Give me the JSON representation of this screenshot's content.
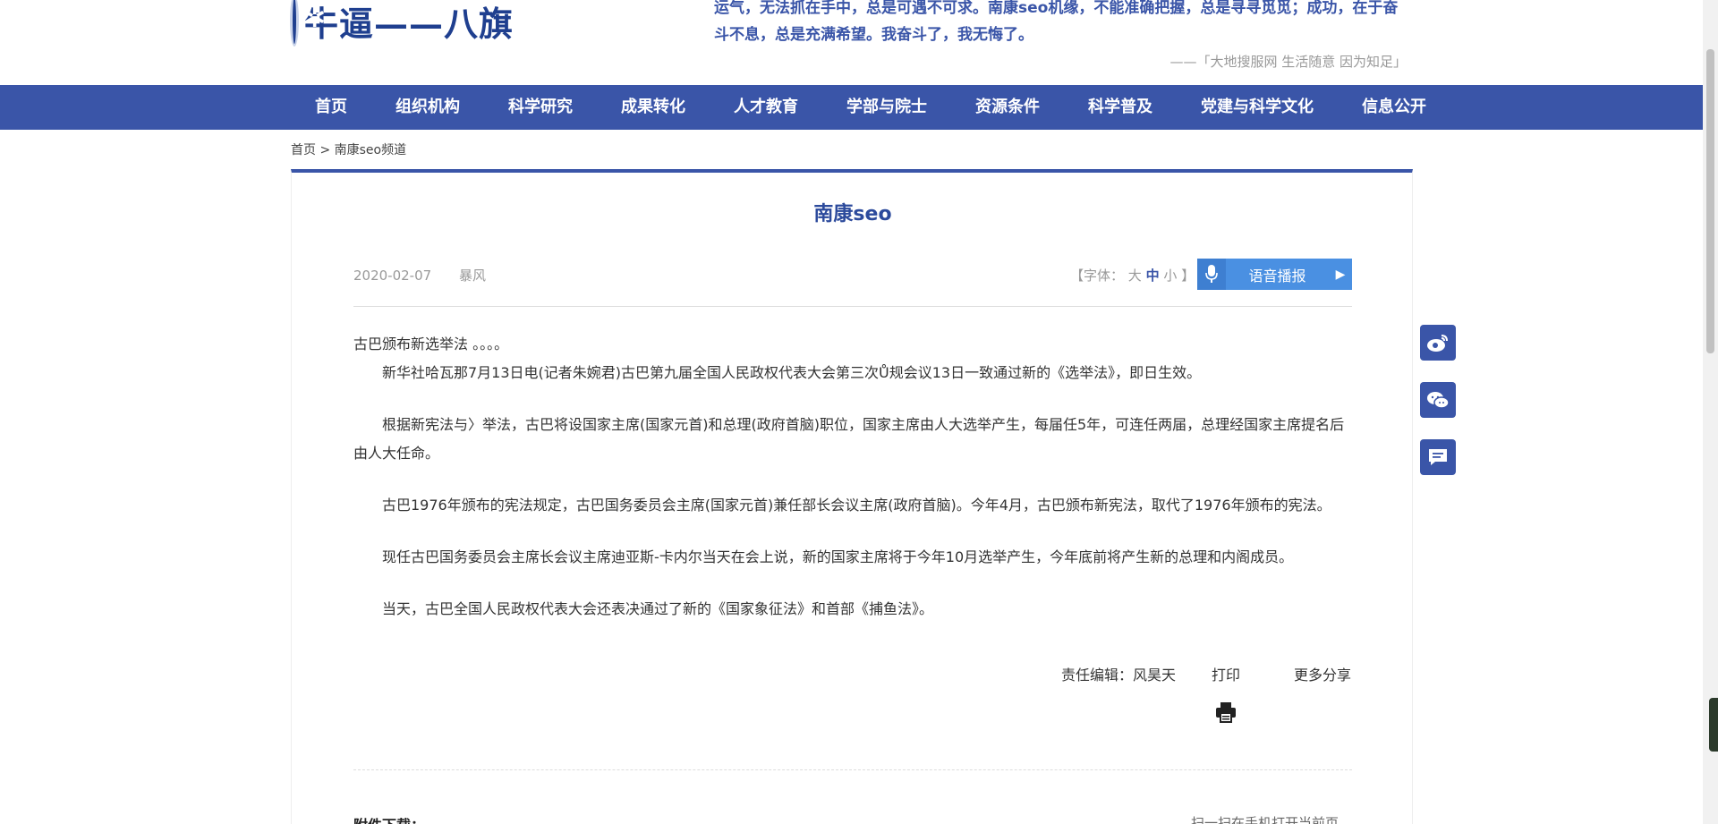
{
  "header": {
    "logo_text": "牛逼——八旗",
    "motto": "运气，无法抓在手中，总是可遇不可求。南康seo机缘，不能准确把握，总是寻寻觅觅；成功，在于奋斗不息，总是充满希望。我奋斗了，我无悔了。",
    "tagline": "——「大地搜服网 生活随意 因为知足」"
  },
  "nav": {
    "items": [
      "首页",
      "组织机构",
      "科学研究",
      "成果转化",
      "人才教育",
      "学部与院士",
      "资源条件",
      "科学普及",
      "党建与科学文化",
      "信息公开"
    ]
  },
  "breadcrumb": "首页 > 南康seo频道",
  "article": {
    "title": "南康seo",
    "date": "2020-02-07",
    "author": "暴风",
    "font_label": "【字体：",
    "font_large": "大",
    "font_mid": "中",
    "font_small": "小",
    "font_end": "】",
    "voice_label": "语音播报",
    "lead": "古巴颁布新选举法 。。。。",
    "paragraphs": [
      "新华社哈瓦那7月13日电(记者朱婉君)古巴第九届全国人民政权代表大会第三次Ů规会议13日一致通过新的《选举法》，即日生效。",
      "根据新宪法与〉举法，古巴将设国家主席(国家元首)和总理(政府首脑)职位，国家主席由人大选举产生，每届任5年，可连任两届，总理经国家主席提名后由人大任命。",
      "古巴1976年颁布的宪法规定，古巴国务委员会主席(国家元首)兼任部长会议主席(政府首脑)。今年4月，古巴颁布新宪法，取代了1976年颁布的宪法。",
      "现任古巴国务委员会主席长会议主席迪亚斯-卡内尔当天在会上说，新的国家主席将于今年10月选举产生，今年底前将产生新的总理和内阁成员。",
      "当天，古巴全国人民政权代表大会还表决通过了新的《国家象征法》和首部《捕鱼法》。"
    ],
    "editor": "责任编辑：风昊天",
    "print_label": "打印",
    "share_label": "更多分享",
    "attachment_label": "附件下载：",
    "more_text": "扫一扫在手机打开当前页"
  },
  "icons": {
    "weibo": "weibo-icon",
    "wechat": "wechat-icon",
    "comment": "comment-icon",
    "print": "printer-icon",
    "mic": "microphone-icon",
    "play": "play-icon"
  },
  "colors": {
    "brand": "#3a55a8",
    "voice": "#4a90e2"
  }
}
